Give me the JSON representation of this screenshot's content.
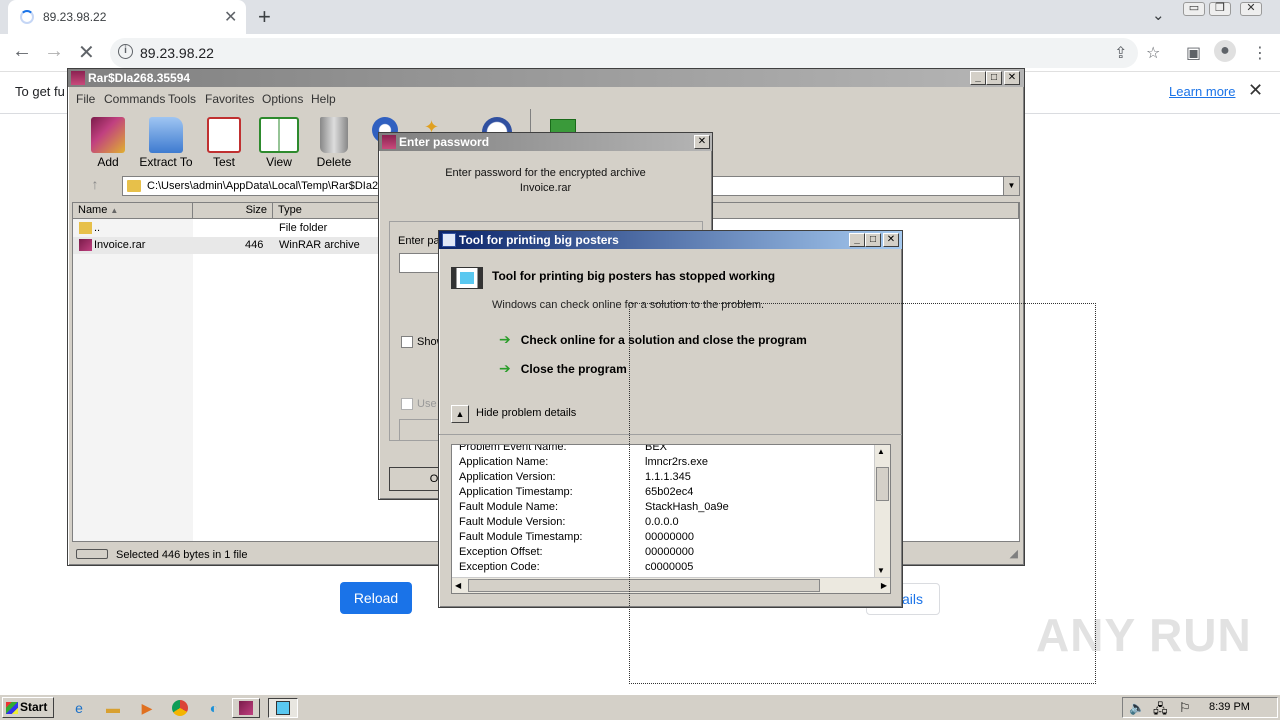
{
  "browser": {
    "tab_title": "89.23.98.22",
    "url": "89.23.98.22",
    "infobar_text": "To get fu",
    "learn_more": "Learn more",
    "reload_label": "Reload",
    "details_label": "ails"
  },
  "watermark": "ANY RUN",
  "winrar": {
    "title": "Rar$DIa268.35594",
    "menu": [
      "File",
      "Commands",
      "Tools",
      "Favorites",
      "Options",
      "Help"
    ],
    "tools": [
      "Add",
      "Extract To",
      "Test",
      "View",
      "Delete"
    ],
    "path": "C:\\Users\\admin\\AppData\\Local\\Temp\\Rar$DIa26",
    "columns": [
      "Name",
      "Size",
      "Type"
    ],
    "files": [
      {
        "name": "..",
        "size": "",
        "type": "File folder"
      },
      {
        "name": "Invoice.rar",
        "size": "446",
        "type": "WinRAR archive"
      }
    ],
    "status": "Selected 446 bytes in 1 file"
  },
  "password_dialog": {
    "title": "Enter password",
    "line1": "Enter password for the encrypted archive",
    "line2": "Invoice.rar",
    "enter_label": "Enter pa",
    "show_label": "Show",
    "use_label": "Use",
    "ok_label": "O"
  },
  "crash_dialog": {
    "title": "Tool for printing big posters",
    "heading": "Tool for printing big posters has stopped working",
    "subtext": "Windows can check online for a solution to the problem.",
    "option1": "Check online for a solution and close the program",
    "option2": "Close the program",
    "hide_details": "Hide problem details",
    "details": [
      {
        "key": "Problem Event Name:",
        "value": "BEX"
      },
      {
        "key": "Application Name:",
        "value": "lmncr2rs.exe"
      },
      {
        "key": "Application Version:",
        "value": "1.1.1.345"
      },
      {
        "key": "Application Timestamp:",
        "value": "65b02ec4"
      },
      {
        "key": "Fault Module Name:",
        "value": "StackHash_0a9e"
      },
      {
        "key": "Fault Module Version:",
        "value": "0.0.0.0"
      },
      {
        "key": "Fault Module Timestamp:",
        "value": "00000000"
      },
      {
        "key": "Exception Offset:",
        "value": "00000000"
      },
      {
        "key": "Exception Code:",
        "value": "c0000005"
      }
    ]
  },
  "taskbar": {
    "start_label": "Start",
    "time": "8:39 PM"
  }
}
